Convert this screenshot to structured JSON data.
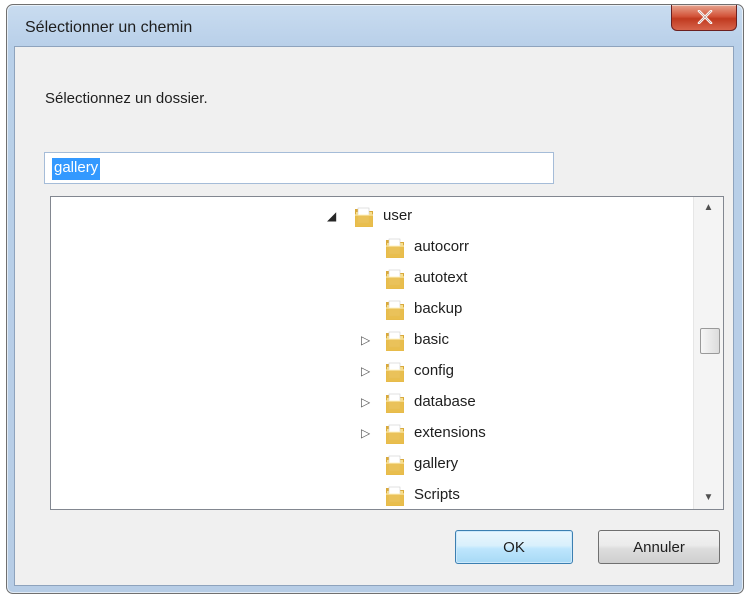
{
  "window": {
    "title": "Sélectionner un chemin",
    "close_label": "X"
  },
  "dialog": {
    "instruction": "Sélectionnez un dossier.",
    "path_input": {
      "value": "gallery",
      "selected": true
    }
  },
  "tree": {
    "items": [
      {
        "label": "user",
        "expander": "expanded",
        "depth": 0
      },
      {
        "label": "autocorr",
        "expander": "none",
        "depth": 1
      },
      {
        "label": "autotext",
        "expander": "none",
        "depth": 1
      },
      {
        "label": "backup",
        "expander": "none",
        "depth": 1
      },
      {
        "label": "basic",
        "expander": "collapsed",
        "depth": 1
      },
      {
        "label": "config",
        "expander": "collapsed",
        "depth": 1
      },
      {
        "label": "database",
        "expander": "collapsed",
        "depth": 1
      },
      {
        "label": "extensions",
        "expander": "collapsed",
        "depth": 1
      },
      {
        "label": "gallery",
        "expander": "none",
        "depth": 1
      },
      {
        "label": "Scripts",
        "expander": "none",
        "depth": 1
      }
    ],
    "scroll_position": 0.45
  },
  "buttons": {
    "ok_label": "OK",
    "cancel_label": "Annuler"
  },
  "icons": {
    "folder": "folder-icon",
    "expanded": "triangle-down-icon",
    "collapsed": "triangle-right-icon",
    "scroll_up": "scroll-up-arrow-icon",
    "scroll_down": "scroll-down-arrow-icon",
    "close": "close-icon"
  },
  "colors": {
    "selection": "#3399ff",
    "close_button": "#c8462b",
    "folder": "#e8c15a",
    "ok_button": "#bee6fd"
  }
}
